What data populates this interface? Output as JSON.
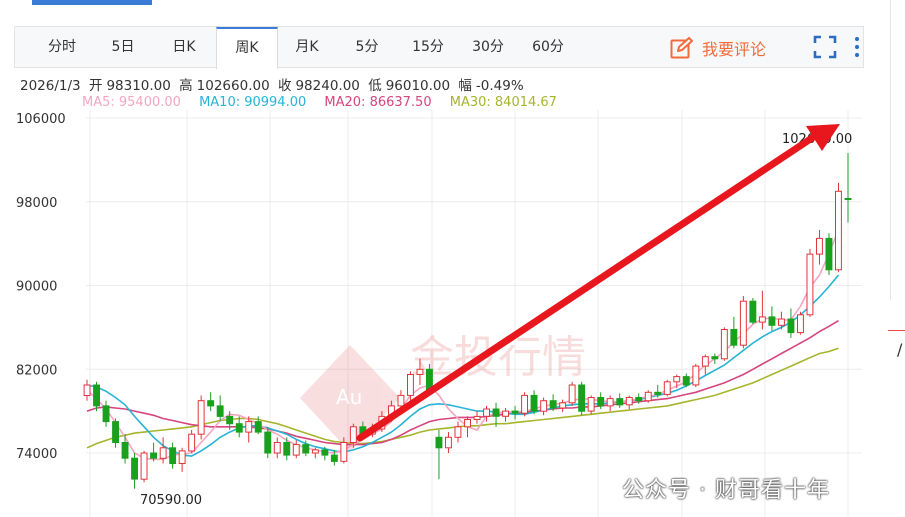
{
  "tabs": [
    "分时",
    "5日",
    "日K",
    "周K",
    "月K",
    "5分",
    "15分",
    "30分",
    "60分"
  ],
  "active_tab": "周K",
  "comment_label": "我要评论",
  "info": {
    "date": "2026/1/3",
    "open_label": "开",
    "open": "98310.00",
    "high_label": "高",
    "high": "102660.00",
    "close_label": "收",
    "close": "98240.00",
    "low_label": "低",
    "low": "96010.00",
    "change_label": "幅",
    "change": "-0.49%"
  },
  "ma_legend": {
    "ma5": "MA5: 95400.00",
    "ma10": "MA10: 90994.00",
    "ma20": "MA20: 86637.50",
    "ma30": "MA30: 84014.67"
  },
  "colors": {
    "up": "#e0353a",
    "down": "#19a11d",
    "ma5": "#f4a6c0",
    "ma10": "#27b3d6",
    "ma20": "#d6457d",
    "ma30": "#a6b52c",
    "arrow": "#e8161d",
    "accent": "#f26b3a",
    "tab_active": "#3a7bd5"
  },
  "watermark_main": "金投行情",
  "watermark_small": "Au",
  "watermark_wechat": "公众号 · 财哥看十年",
  "chart_data": {
    "type": "candlestick",
    "y_ticks": [
      "106000",
      "98000",
      "90000",
      "82000",
      "74000"
    ],
    "ylim": [
      70000,
      108000
    ],
    "annotations": {
      "max_label": "102660.00",
      "min_label": "70590.00"
    },
    "candles": [
      [
        79500,
        81000,
        79000,
        80500
      ],
      [
        80500,
        80800,
        78000,
        78500
      ],
      [
        78500,
        79000,
        76500,
        77000
      ],
      [
        77000,
        77300,
        74500,
        75000
      ],
      [
        75000,
        75800,
        73000,
        73500
      ],
      [
        73500,
        74000,
        70590,
        71500
      ],
      [
        71500,
        74200,
        71200,
        74000
      ],
      [
        74000,
        75000,
        73200,
        73500
      ],
      [
        73500,
        75500,
        73000,
        74500
      ],
      [
        74500,
        75000,
        72500,
        73000
      ],
      [
        73000,
        74500,
        72200,
        74200
      ],
      [
        74200,
        76200,
        74000,
        75800
      ],
      [
        75800,
        79500,
        75300,
        79000
      ],
      [
        79000,
        79800,
        78000,
        78500
      ],
      [
        78500,
        79500,
        77000,
        77500
      ],
      [
        77500,
        78000,
        76200,
        76800
      ],
      [
        76800,
        77500,
        75500,
        76000
      ],
      [
        76000,
        77500,
        75000,
        77000
      ],
      [
        77000,
        77500,
        75800,
        76000
      ],
      [
        76000,
        76500,
        73500,
        74000
      ],
      [
        74000,
        75500,
        73500,
        75000
      ],
      [
        75000,
        75500,
        73300,
        73800
      ],
      [
        73800,
        75200,
        73500,
        74800
      ],
      [
        74800,
        75200,
        73700,
        74000
      ],
      [
        74000,
        74500,
        73500,
        74300
      ],
      [
        74300,
        74600,
        73300,
        73800
      ],
      [
        73800,
        74300,
        72800,
        73200
      ],
      [
        73200,
        75500,
        73000,
        75000
      ],
      [
        75000,
        76800,
        74500,
        76500
      ],
      [
        76500,
        77000,
        75300,
        75800
      ],
      [
        75800,
        76800,
        75500,
        76300
      ],
      [
        76300,
        78000,
        76000,
        77500
      ],
      [
        77500,
        79000,
        77000,
        78500
      ],
      [
        78500,
        80000,
        78000,
        79500
      ],
      [
        79500,
        81800,
        79000,
        81500
      ],
      [
        81500,
        83000,
        80500,
        82000
      ],
      [
        82000,
        82500,
        79500,
        80000
      ],
      [
        75500,
        76200,
        71500,
        74500
      ],
      [
        74500,
        76000,
        74000,
        75500
      ],
      [
        75500,
        77000,
        75000,
        76500
      ],
      [
        76500,
        77500,
        75500,
        77200
      ],
      [
        77200,
        78000,
        76800,
        77500
      ],
      [
        77500,
        78500,
        77000,
        78200
      ],
      [
        78200,
        78800,
        76500,
        77500
      ],
      [
        77500,
        78300,
        77000,
        78000
      ],
      [
        78000,
        78500,
        77200,
        77800
      ],
      [
        77800,
        79800,
        77500,
        79500
      ],
      [
        79500,
        80000,
        77700,
        78000
      ],
      [
        78000,
        79300,
        77600,
        79000
      ],
      [
        79000,
        79600,
        78000,
        78300
      ],
      [
        78300,
        79100,
        77900,
        78800
      ],
      [
        78800,
        80800,
        78500,
        80500
      ],
      [
        80500,
        80800,
        77600,
        78000
      ],
      [
        78000,
        79500,
        77700,
        79300
      ],
      [
        79300,
        79800,
        78200,
        78500
      ],
      [
        78500,
        79500,
        78000,
        79200
      ],
      [
        79200,
        79700,
        78300,
        78600
      ],
      [
        78600,
        79500,
        78200,
        79300
      ],
      [
        79300,
        79700,
        78700,
        79000
      ],
      [
        79000,
        80000,
        78800,
        79800
      ],
      [
        79800,
        80500,
        79300,
        79600
      ],
      [
        79600,
        81000,
        79400,
        80800
      ],
      [
        80800,
        81500,
        80200,
        81300
      ],
      [
        81300,
        81600,
        80300,
        80500
      ],
      [
        80500,
        82500,
        80300,
        82300
      ],
      [
        82300,
        83400,
        81500,
        83200
      ],
      [
        83200,
        83500,
        82500,
        83000
      ],
      [
        83000,
        86000,
        82800,
        85800
      ],
      [
        85800,
        87000,
        84000,
        84300
      ],
      [
        84300,
        89000,
        84000,
        88500
      ],
      [
        88500,
        88800,
        86300,
        86500
      ],
      [
        86500,
        89500,
        85800,
        87000
      ],
      [
        87000,
        88000,
        85700,
        86200
      ],
      [
        86200,
        87500,
        85800,
        86800
      ],
      [
        86800,
        87800,
        85000,
        85500
      ],
      [
        85500,
        87500,
        85300,
        87200
      ],
      [
        87200,
        93500,
        87000,
        93000
      ],
      [
        93000,
        95300,
        92000,
        94500
      ],
      [
        94500,
        95000,
        91000,
        91500
      ],
      [
        91500,
        99800,
        91300,
        99000
      ],
      [
        98310,
        102660,
        96010,
        98240
      ]
    ],
    "ma5": [
      80000,
      79200,
      78200,
      76900,
      75500,
      74000,
      73500,
      73400,
      73400,
      73800,
      73900,
      74000,
      75000,
      76000,
      77100,
      77700,
      77600,
      77200,
      76800,
      76200,
      75800,
      75200,
      74800,
      74500,
      74300,
      74100,
      74000,
      74300,
      74800,
      75300,
      75800,
      76300,
      77000,
      78200,
      79500,
      80200,
      80500,
      79500,
      78200,
      77300,
      76500,
      76200,
      77500,
      77800,
      77900,
      77900,
      78000,
      78200,
      78500,
      78600,
      78800,
      79000,
      79200,
      79100,
      79000,
      78900,
      78900,
      79000,
      79200,
      79400,
      79600,
      80000,
      80400,
      80800,
      81600,
      82400,
      83000,
      83700,
      84600,
      85400,
      86300,
      86800,
      86900,
      86700,
      86700,
      88000,
      89800,
      91000,
      93000,
      95400
    ],
    "ma10": [
      80500,
      80300,
      79900,
      79300,
      78600,
      77500,
      76500,
      75500,
      74700,
      74200,
      73800,
      73700,
      74200,
      74800,
      75500,
      76000,
      76400,
      76600,
      76600,
      76400,
      76100,
      75800,
      75300,
      74900,
      74600,
      74400,
      74200,
      74100,
      74300,
      74600,
      75000,
      75500,
      76000,
      76700,
      77500,
      78200,
      78600,
      78700,
      78600,
      78400,
      78200,
      78000,
      78000,
      77900,
      77800,
      77700,
      77700,
      77900,
      78100,
      78300,
      78500,
      78600,
      78700,
      78700,
      78700,
      78800,
      78900,
      79000,
      79100,
      79300,
      79500,
      79700,
      80000,
      80400,
      80900,
      81400,
      81900,
      82400,
      83100,
      83800,
      84500,
      85100,
      85600,
      86000,
      86500,
      87200,
      88000,
      88900,
      89900,
      90994
    ],
    "ma20": [
      78000,
      78300,
      78400,
      78300,
      78200,
      78000,
      77800,
      77600,
      77300,
      77100,
      76900,
      76700,
      76600,
      76500,
      76500,
      76500,
      76500,
      76500,
      76400,
      76300,
      76100,
      75900,
      75600,
      75400,
      75200,
      75000,
      74900,
      74800,
      74800,
      74800,
      74900,
      75000,
      75300,
      75700,
      76200,
      76600,
      77000,
      77200,
      77300,
      77400,
      77400,
      77400,
      77500,
      77600,
      77700,
      77800,
      77900,
      78000,
      78100,
      78200,
      78300,
      78300,
      78400,
      78400,
      78500,
      78600,
      78700,
      78800,
      78900,
      79000,
      79100,
      79200,
      79400,
      79600,
      79800,
      80100,
      80400,
      80700,
      81100,
      81500,
      82000,
      82500,
      83000,
      83500,
      84000,
      84500,
      85000,
      85600,
      86100,
      86637
    ],
    "ma30": [
      74500,
      74900,
      75200,
      75500,
      75700,
      75900,
      76000,
      76100,
      76200,
      76300,
      76400,
      76500,
      76700,
      76900,
      77100,
      77200,
      77300,
      77300,
      77200,
      77000,
      76800,
      76500,
      76200,
      75900,
      75600,
      75300,
      75100,
      75000,
      74900,
      74900,
      75000,
      75100,
      75300,
      75500,
      75700,
      76000,
      76200,
      76300,
      76400,
      76500,
      76600,
      76600,
      76700,
      76800,
      76800,
      76900,
      77000,
      77100,
      77200,
      77300,
      77400,
      77500,
      77600,
      77700,
      77800,
      77900,
      78000,
      78100,
      78200,
      78300,
      78400,
      78500,
      78700,
      78900,
      79100,
      79300,
      79500,
      79800,
      80100,
      80400,
      80700,
      81100,
      81500,
      81900,
      82300,
      82700,
      83100,
      83500,
      83700,
      84014
    ]
  }
}
